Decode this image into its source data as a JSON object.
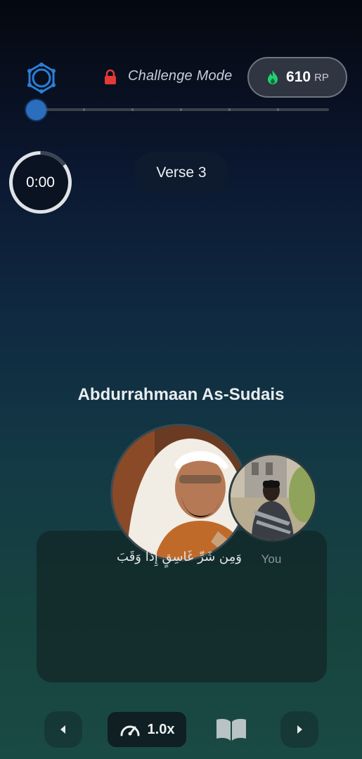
{
  "header": {
    "mode_label": "Challenge Mode",
    "rp_value": "610",
    "rp_unit": "RP",
    "icons": {
      "logo": "hexagon-logo-icon",
      "lock": "lock-icon",
      "flame": "flame-icon"
    },
    "colors": {
      "accent": "#2a6ebd",
      "flame": "#20d070",
      "lock": "#e53935"
    }
  },
  "progress": {
    "value": 0,
    "tick_count": 7
  },
  "timer": {
    "text": "0:00",
    "fraction": 0.15
  },
  "verse_badge": {
    "label": "Verse 3"
  },
  "reciter": {
    "name": "Abdurrahmaan As-Sudais"
  },
  "recitation": {
    "arabic_text": "وَمِن شَرِّ غَاسِقٍ إِذَا وَقَبَ",
    "you_label": "You"
  },
  "controls": {
    "speed_label": "1.0x",
    "icons": {
      "prev": "chevron-left-icon",
      "speed": "speedometer-icon",
      "book": "book-open-icon",
      "next": "chevron-right-icon"
    }
  }
}
